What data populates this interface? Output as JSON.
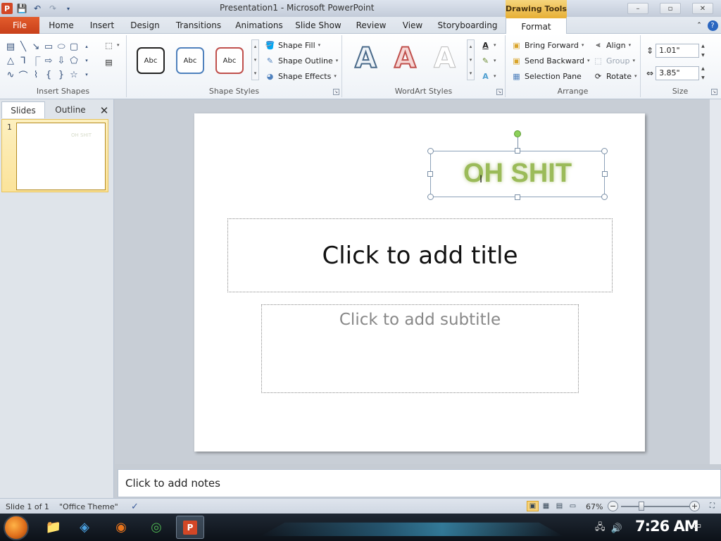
{
  "window": {
    "title": "Presentation1 - Microsoft PowerPoint",
    "contextual_tab": "Drawing Tools",
    "controls": {
      "minimize": "–",
      "restore": "▫",
      "close": "✕"
    }
  },
  "tabs": [
    "File",
    "Home",
    "Insert",
    "Design",
    "Transitions",
    "Animations",
    "Slide Show",
    "Review",
    "View",
    "Storyboarding",
    "Format"
  ],
  "ribbon": {
    "insert_shapes": {
      "label": "Insert Shapes"
    },
    "shape_styles": {
      "label": "Shape Styles",
      "presets": [
        "Abc",
        "Abc",
        "Abc"
      ],
      "fill": "Shape Fill",
      "outline": "Shape Outline",
      "effects": "Shape Effects"
    },
    "wordart_styles": {
      "label": "WordArt Styles",
      "presets": [
        "A",
        "A",
        "A"
      ]
    },
    "arrange": {
      "label": "Arrange",
      "bring_forward": "Bring Forward",
      "send_backward": "Send Backward",
      "selection_pane": "Selection Pane",
      "align": "Align",
      "group": "Group",
      "rotate": "Rotate"
    },
    "size": {
      "label": "Size",
      "height": "1.01\"",
      "width": "3.85\""
    }
  },
  "left_pane": {
    "tabs": [
      "Slides",
      "Outline"
    ],
    "close": "✕",
    "slides": [
      {
        "number": "1"
      }
    ]
  },
  "slide": {
    "wordart_text": "OH SHIT",
    "title_placeholder": "Click to add title",
    "subtitle_placeholder": "Click to add subtitle"
  },
  "notes": {
    "placeholder": "Click to add notes"
  },
  "status": {
    "slide_count": "Slide 1 of 1",
    "theme": "\"Office Theme\"",
    "zoom": "67%",
    "zoom_level_pct": 67
  },
  "taskbar": {
    "clock": "7:26 AM"
  },
  "colors": {
    "accent_file": "#d24726",
    "drawing_tools": "#e8b23a",
    "wordart_green": "#9bbb59"
  }
}
